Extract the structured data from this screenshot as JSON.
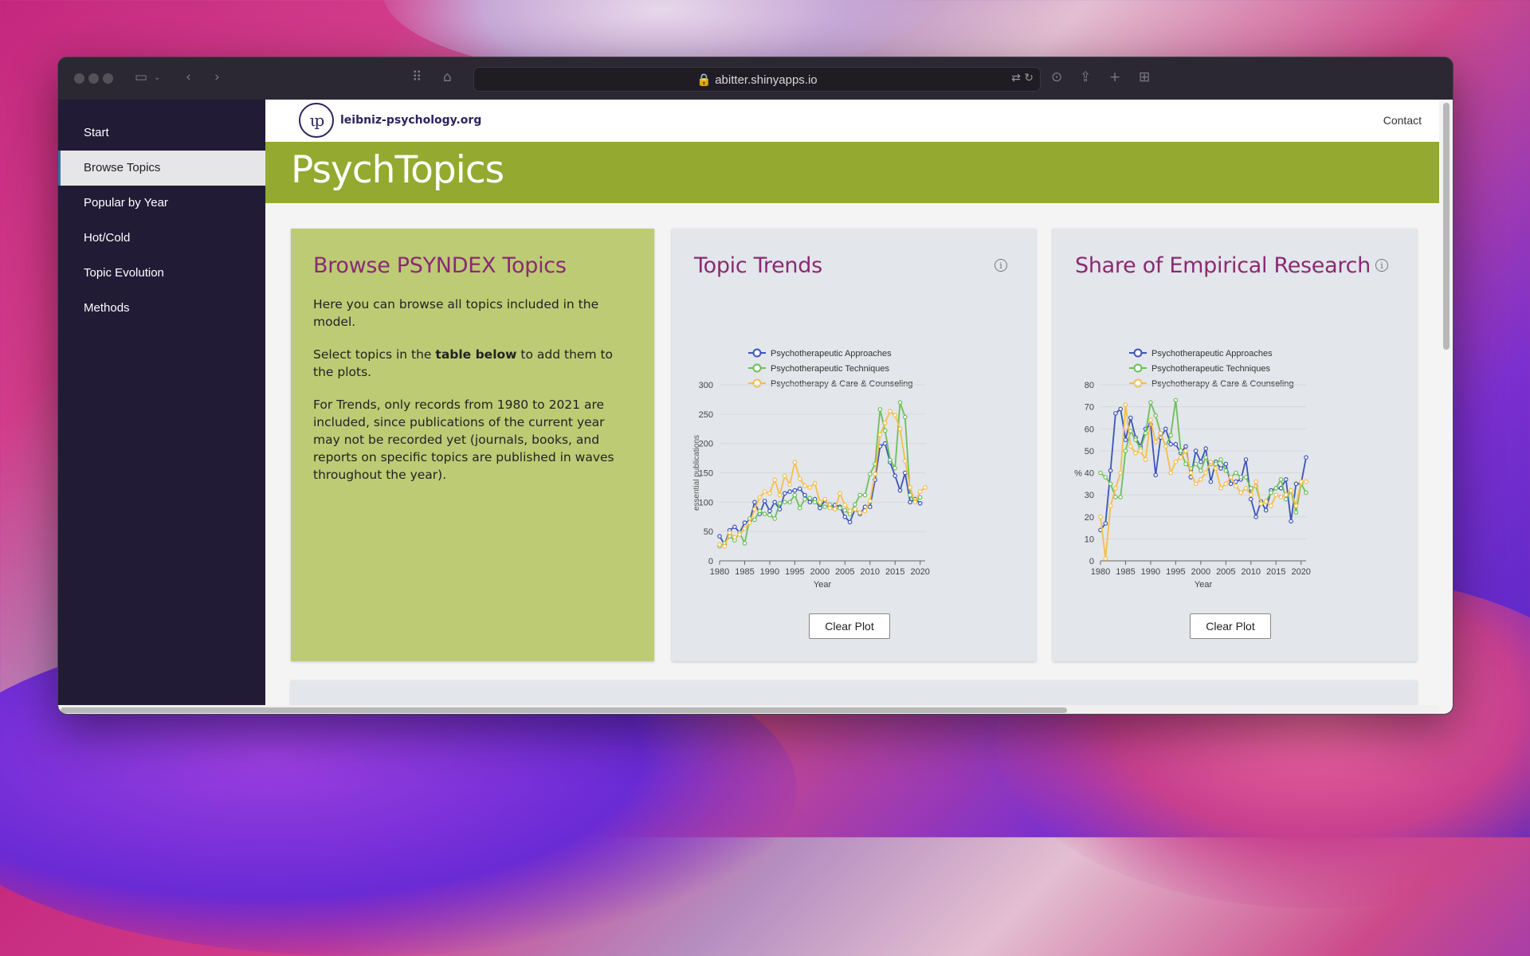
{
  "browser": {
    "url": "abitter.shinyapps.io"
  },
  "sidebar": {
    "items": [
      {
        "label": "Start"
      },
      {
        "label": "Browse Topics"
      },
      {
        "label": "Popular by Year"
      },
      {
        "label": "Hot/Cold"
      },
      {
        "label": "Topic Evolution"
      },
      {
        "label": "Methods"
      }
    ],
    "active": "Browse Topics"
  },
  "header": {
    "logo_mark": "ιp",
    "logo_text": "leibniz-psychology.org",
    "contact": "Contact",
    "title": "PsychTopics"
  },
  "browse": {
    "title": "Browse PSYNDEX Topics",
    "p1": "Here you can browse all topics included in the model.",
    "p2_pre": "Select topics in the ",
    "p2_bold": "table below",
    "p2_post": " to add them to the plots.",
    "p3": "For Trends, only records from 1980 to 2021 are included, since publications of the current year may not be recorded yet (journals, books, and reports on specific topics are published in waves throughout the year)."
  },
  "trends": {
    "title": "Topic Trends",
    "clear_label": "Clear Plot"
  },
  "empirical": {
    "title": "Share of Empirical Research",
    "clear_label": "Clear Plot"
  },
  "colors": {
    "approaches": "#3b55b8",
    "techniques": "#6cbf5a",
    "counseling": "#f7bd4a",
    "banner": "#93a930",
    "title": "#8a2a73"
  },
  "chart_data": [
    {
      "type": "line",
      "title": "Topic Trends",
      "xlabel": "Year",
      "ylabel": "essential publications",
      "xlim": [
        1980,
        2021
      ],
      "ylim": [
        0,
        300
      ],
      "xticks": [
        1980,
        1985,
        1990,
        1995,
        2000,
        2005,
        2010,
        2015,
        2020
      ],
      "yticks": [
        0,
        50,
        100,
        150,
        200,
        250,
        300
      ],
      "grid": true,
      "legend": "top",
      "x": [
        1980,
        1981,
        1982,
        1983,
        1984,
        1985,
        1986,
        1987,
        1988,
        1989,
        1990,
        1991,
        1992,
        1993,
        1994,
        1995,
        1996,
        1997,
        1998,
        1999,
        2000,
        2001,
        2002,
        2003,
        2004,
        2005,
        2006,
        2007,
        2008,
        2009,
        2010,
        2011,
        2012,
        2013,
        2014,
        2015,
        2016,
        2017,
        2018,
        2019,
        2020,
        2021
      ],
      "series": [
        {
          "name": "Psychotherapeutic Approaches",
          "values": [
            42,
            28,
            52,
            58,
            48,
            65,
            68,
            100,
            80,
            102,
            85,
            100,
            88,
            115,
            118,
            120,
            123,
            112,
            100,
            105,
            90,
            103,
            92,
            95,
            92,
            75,
            66,
            88,
            80,
            92,
            92,
            138,
            195,
            200,
            168,
            145,
            120,
            150,
            100,
            105,
            98
          ]
        },
        {
          "name": "Psychotherapeutic Techniques",
          "values": [
            25,
            30,
            42,
            35,
            48,
            30,
            72,
            70,
            85,
            80,
            78,
            72,
            98,
            100,
            100,
            112,
            90,
            105,
            107,
            100,
            98,
            92,
            96,
            88,
            90,
            86,
            80,
            96,
            112,
            112,
            148,
            165,
            258,
            222,
            172,
            158,
            270,
            245,
            112,
            100,
            108
          ]
        },
        {
          "name": "Psychotherapy & Care & Counseling",
          "values": [
            28,
            25,
            48,
            40,
            45,
            55,
            65,
            88,
            108,
            118,
            115,
            138,
            112,
            145,
            130,
            168,
            140,
            128,
            125,
            132,
            100,
            105,
            90,
            88,
            115,
            95,
            85,
            88,
            82,
            85,
            102,
            148,
            215,
            235,
            255,
            248,
            225,
            170,
            125,
            100,
            118,
            125
          ]
        }
      ]
    },
    {
      "type": "line",
      "title": "Share of Empirical Research",
      "xlabel": "Year",
      "ylabel": "%",
      "xlim": [
        1980,
        2021
      ],
      "ylim": [
        0,
        80
      ],
      "xticks": [
        1980,
        1985,
        1990,
        1995,
        2000,
        2005,
        2010,
        2015,
        2020
      ],
      "yticks": [
        0,
        10,
        20,
        30,
        40,
        50,
        60,
        70,
        80
      ],
      "grid": true,
      "legend": "top",
      "x": [
        1980,
        1981,
        1982,
        1983,
        1984,
        1985,
        1986,
        1987,
        1988,
        1989,
        1990,
        1991,
        1992,
        1993,
        1994,
        1995,
        1996,
        1997,
        1998,
        1999,
        2000,
        2001,
        2002,
        2003,
        2004,
        2005,
        2006,
        2007,
        2008,
        2009,
        2010,
        2011,
        2012,
        2013,
        2014,
        2015,
        2016,
        2017,
        2018,
        2019,
        2020,
        2021
      ],
      "series": [
        {
          "name": "Psychotherapeutic Approaches",
          "values": [
            14,
            17,
            41,
            67,
            69,
            55,
            65,
            56,
            52,
            60,
            62,
            39,
            56,
            60,
            53,
            53,
            49,
            52,
            38,
            50,
            45,
            51,
            36,
            45,
            42,
            44,
            35,
            36,
            37,
            46,
            28,
            20,
            27,
            23,
            32,
            33,
            33,
            37,
            18,
            35,
            35,
            47
          ]
        },
        {
          "name": "Psychotherapeutic Techniques",
          "values": [
            40,
            38,
            35,
            29,
            29,
            50,
            59,
            55,
            51,
            58,
            72,
            66,
            58,
            52,
            57,
            73,
            50,
            44,
            42,
            44,
            41,
            47,
            44,
            44,
            46,
            41,
            38,
            40,
            38,
            38,
            33,
            34,
            26,
            27,
            31,
            33,
            37,
            28,
            32,
            22,
            35,
            31
          ]
        },
        {
          "name": "Psychotherapy & Care & Counseling",
          "values": [
            20,
            1,
            25,
            33,
            40,
            71,
            52,
            49,
            50,
            46,
            64,
            54,
            58,
            52,
            40,
            45,
            47,
            50,
            40,
            35,
            37,
            40,
            45,
            42,
            33,
            35,
            38,
            34,
            31,
            33,
            30,
            36,
            26,
            27,
            25,
            30,
            29,
            30,
            32,
            25,
            36,
            36
          ]
        }
      ]
    }
  ]
}
